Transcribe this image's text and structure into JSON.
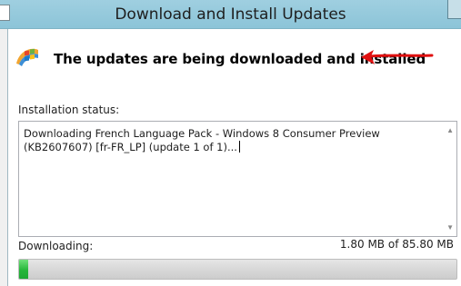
{
  "window": {
    "title": "Download and Install Updates"
  },
  "header": {
    "icon": "windows-update-icon",
    "headline": "The updates are being downloaded and installed",
    "annotation": "red-arrow-icon"
  },
  "installation": {
    "label": "Installation status:",
    "text": "Downloading French Language Pack - Windows 8 Consumer Preview (KB2607607) [fr-FR_LP] (update 1 of 1)..."
  },
  "download": {
    "label": "Downloading:",
    "size_text": "1.80 MB of 85.80 MB",
    "progress_fraction": 0.021
  },
  "colors": {
    "titlebar": "#9fcfe0",
    "progress_green": "#26b63a",
    "arrow_red": "#e01010"
  }
}
